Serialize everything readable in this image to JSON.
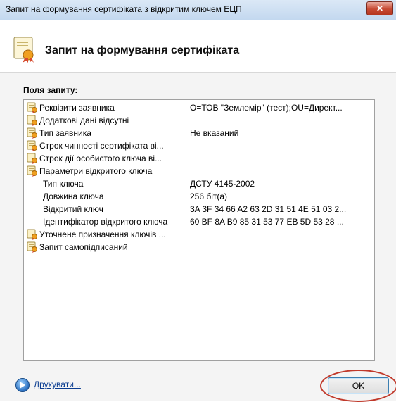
{
  "window": {
    "title": "Запит на формування сертифіката з відкритим ключем ЕЦП",
    "close_label": "✕"
  },
  "header": {
    "title": "Запит на формування сертифіката",
    "icon": "certificate-icon"
  },
  "fields": {
    "label": "Поля запиту:",
    "rows": [
      {
        "name": "Реквізити заявника",
        "value": "О=ТОВ \"Землемір\" (тест);OU=Директ...",
        "icon": "certificate-key-icon"
      },
      {
        "name": "Додаткові дані відсутні",
        "value": "",
        "icon": "certificate-key-icon"
      },
      {
        "name": "Тип заявника",
        "value": "Не вказаний",
        "icon": "certificate-key-icon"
      },
      {
        "name": "Строк чинності сертифіката ві...",
        "value": "",
        "icon": "certificate-key-icon"
      },
      {
        "name": "Строк дії особистого ключа ві...",
        "value": "",
        "icon": "certificate-key-icon"
      },
      {
        "name": "Параметри відкритого ключа",
        "value": "",
        "icon": "certificate-key-icon"
      },
      {
        "name": "Тип ключа",
        "value": "ДСТУ 4145-2002"
      },
      {
        "name": "Довжина ключа",
        "value": "256 біт(а)"
      },
      {
        "name": "Відкритий ключ",
        "value": "3A 3F 34 66 A2 63 2D 31 51 4E 51 03 2..."
      },
      {
        "name": "Ідентифікатор відкритого ключа",
        "value": "60 BF 8A B9 85 31 53 77 EB 5D 53 28 ..."
      },
      {
        "name": "Уточнене призначення ключів ...",
        "value": "",
        "icon": "certificate-key-icon"
      },
      {
        "name": "Запит самопідписаний",
        "value": "",
        "icon": "certificate-key-icon"
      }
    ]
  },
  "footer": {
    "print_label": "Друкувати...",
    "ok_label": "OK"
  },
  "colors": {
    "titlebar": "#c3d8ef",
    "annotation_ring": "#c0392b",
    "link": "#0b3d91"
  }
}
